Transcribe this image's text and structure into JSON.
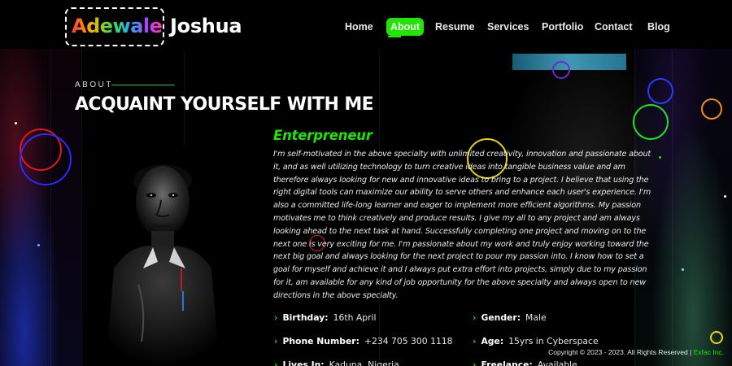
{
  "header": {
    "logo_first": "Adewale",
    "logo_last": "Joshua",
    "nav": [
      {
        "label": "Home",
        "active": false
      },
      {
        "label": "About",
        "active": true
      },
      {
        "label": "Resume",
        "active": false
      },
      {
        "label": "Services",
        "active": false
      },
      {
        "label": "Portfolio",
        "active": false
      },
      {
        "label": "Contact",
        "active": false
      },
      {
        "label": "Blog",
        "active": false
      }
    ]
  },
  "about": {
    "kicker": "ABOUT",
    "title": "ACQUAINT YOURSELF WITH ME",
    "role": "Enterpreneur",
    "bio": "I'm self-motivated in the above specialty with unlimited creativity, innovation and passionate about it, and as well utilizing technology to turn creative ideas into tangible business value and am therefore always looking for new and innovative ideas to bring to a project. I believe that using the right digital tools can maximize our ability to serve others and enhance each user's experience. I'm also a committed life-long learner and eager to implement more efficient algorithms. My passion motivates me to think creatively and produce results. I give my all to any project and am always looking ahead to the next task at hand. Successfully completing one project and moving on to the next one is very exciting for me. I'm passionate about my work and truly enjoy working toward the next big goal and always looking for the next project to pour my passion into. I know how to set a goal for myself and achieve it and I always put extra effort into projects, simply due to my passion for it, am available for any kind of job opportunity for the above specialty and always open to new directions in the above specialty."
  },
  "details": {
    "birthday": {
      "label": "Birthday:",
      "value": "16th April"
    },
    "gender": {
      "label": "Gender:",
      "value": "Male"
    },
    "phone": {
      "label": "Phone Number:",
      "value": "+234 705 300 1118"
    },
    "age": {
      "label": "Age:",
      "value": "15yrs in Cyberspace"
    },
    "lives_in": {
      "label": "Lives In:",
      "value": "Kaduna, Nigeria"
    },
    "freelance": {
      "label": "Freelance:",
      "value": "Available"
    }
  },
  "footer": {
    "copyright": "Copyright © 2023 - 2023. All Rights Reserved |",
    "brand": "Exfac Inc."
  },
  "colors": {
    "accent": "#1ee600",
    "background": "#000000",
    "text": "#ffffff"
  },
  "icons": {
    "detail_bullet": "chevron-right-icon"
  }
}
